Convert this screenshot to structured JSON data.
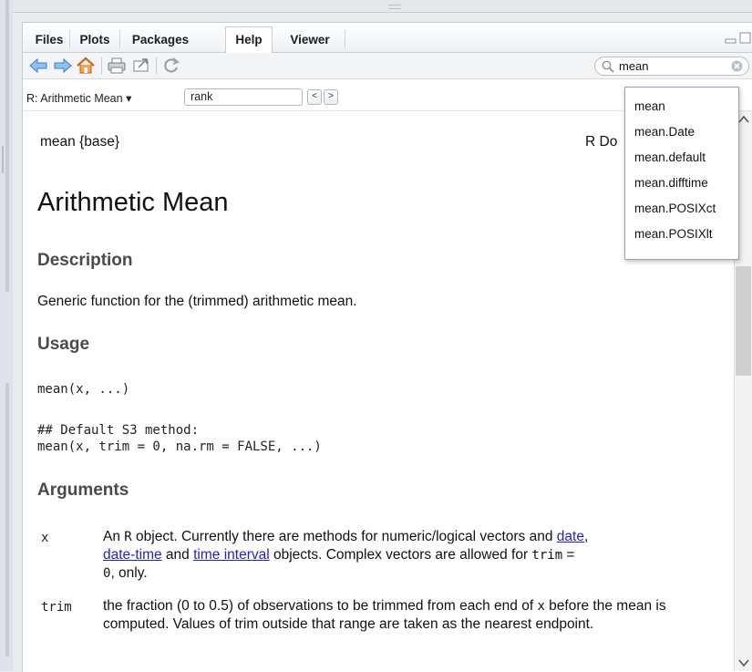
{
  "tabs": [
    {
      "label": "Files",
      "active": false
    },
    {
      "label": "Plots",
      "active": false
    },
    {
      "label": "Packages",
      "active": false
    },
    {
      "label": "Help",
      "active": true
    },
    {
      "label": "Viewer",
      "active": false
    }
  ],
  "toolbar": {
    "icons": [
      "back-arrow-icon",
      "forward-arrow-icon",
      "home-icon",
      "print-icon",
      "open-in-new-window-icon",
      "refresh-icon"
    ],
    "search": {
      "value": "mean",
      "placeholder": ""
    }
  },
  "navbar": {
    "title": "R: Arithmetic Mean ▾",
    "find_value": "rank",
    "prev_label": "<",
    "next_label": ">"
  },
  "doc": {
    "header_left": "mean {base}",
    "header_right": "R Do",
    "title": "Arithmetic Mean",
    "description_heading": "Description",
    "description_text": "Generic function for the (trimmed) arithmetic mean.",
    "usage_heading": "Usage",
    "usage_code_1": "mean(x, ...)",
    "usage_code_2": "## Default S3 method:",
    "usage_code_3": "mean(x, trim = 0, na.rm = FALSE, ...)",
    "arguments_heading": "Arguments",
    "arg_x_name": "x",
    "arg_x_p1": "An ",
    "arg_x_r": "R",
    "arg_x_p2": " object. Currently there are methods for numeric/logical vectors and ",
    "arg_x_link1": "date",
    "arg_x_p3": ",",
    "arg_x_link2": "date-time",
    "arg_x_p4": " and ",
    "arg_x_link3": "time interval",
    "arg_x_p5": " objects. Complex vectors are allowed for ",
    "arg_x_code1": "trim",
    "arg_x_p6": " =",
    "arg_x_code2": "0",
    "arg_x_p7": ", only.",
    "arg_trim_name": "trim",
    "arg_trim_p1": "the fraction (0 to 0.5) of observations to be trimmed from each end of ",
    "arg_trim_code": "x",
    "arg_trim_p2": " before the mean is computed. Values of trim outside that range are taken as the nearest endpoint."
  },
  "dropdown": {
    "items": [
      "mean",
      "mean.Date",
      "mean.default",
      "mean.difftime",
      "mean.POSIXct",
      "mean.POSIXlt"
    ]
  },
  "colors": {
    "link": "#1d1ee0",
    "heading": "#4a4a4a",
    "toolbar_blue": "#4a90d9",
    "home_orange": "#e07a1f"
  }
}
